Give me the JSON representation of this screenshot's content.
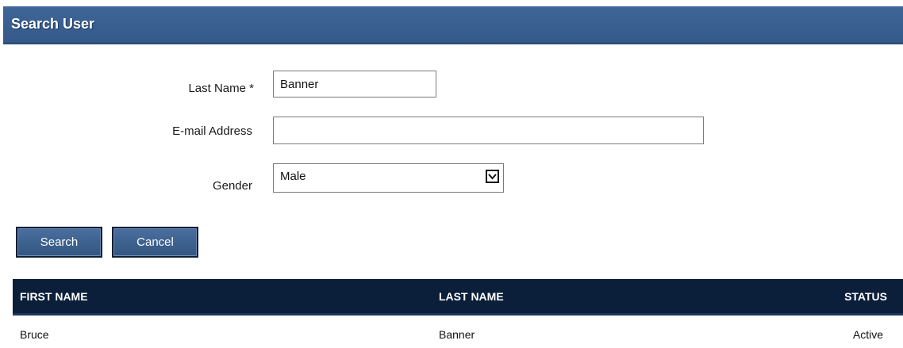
{
  "header": {
    "title": "Search User"
  },
  "form": {
    "last_name": {
      "label": "Last Name *",
      "value": "Banner"
    },
    "email": {
      "label": "E-mail Address",
      "value": ""
    },
    "gender": {
      "label": "Gender",
      "selected": "Male"
    }
  },
  "buttons": {
    "search": "Search",
    "cancel": "Cancel"
  },
  "table": {
    "columns": [
      "FIRST NAME",
      "LAST NAME",
      "STATUS"
    ],
    "rows": [
      [
        "Bruce",
        "Banner",
        "Active"
      ]
    ]
  },
  "colors": {
    "header_bg": "#3a6090",
    "table_header_bg": "#0b1e3a",
    "button_bg": "#3d6192"
  },
  "icons": {
    "select_arrow": "chevron-down-icon"
  }
}
